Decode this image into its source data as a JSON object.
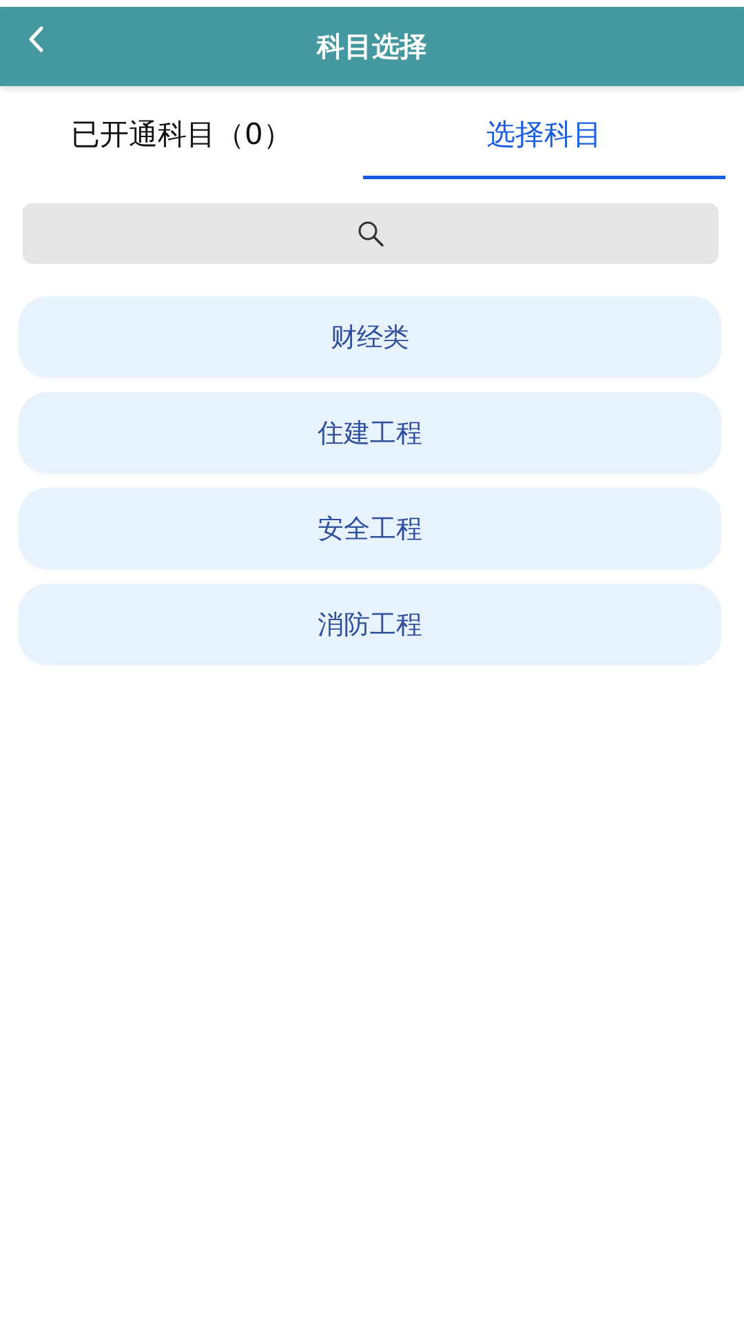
{
  "header": {
    "title": "科目选择"
  },
  "tabs": [
    {
      "label": "已开通科目（0）",
      "selected": false
    },
    {
      "label": "选择科目",
      "selected": true
    }
  ],
  "categories": [
    {
      "label": "财经类"
    },
    {
      "label": "住建工程"
    },
    {
      "label": "安全工程"
    },
    {
      "label": "消防工程"
    }
  ]
}
